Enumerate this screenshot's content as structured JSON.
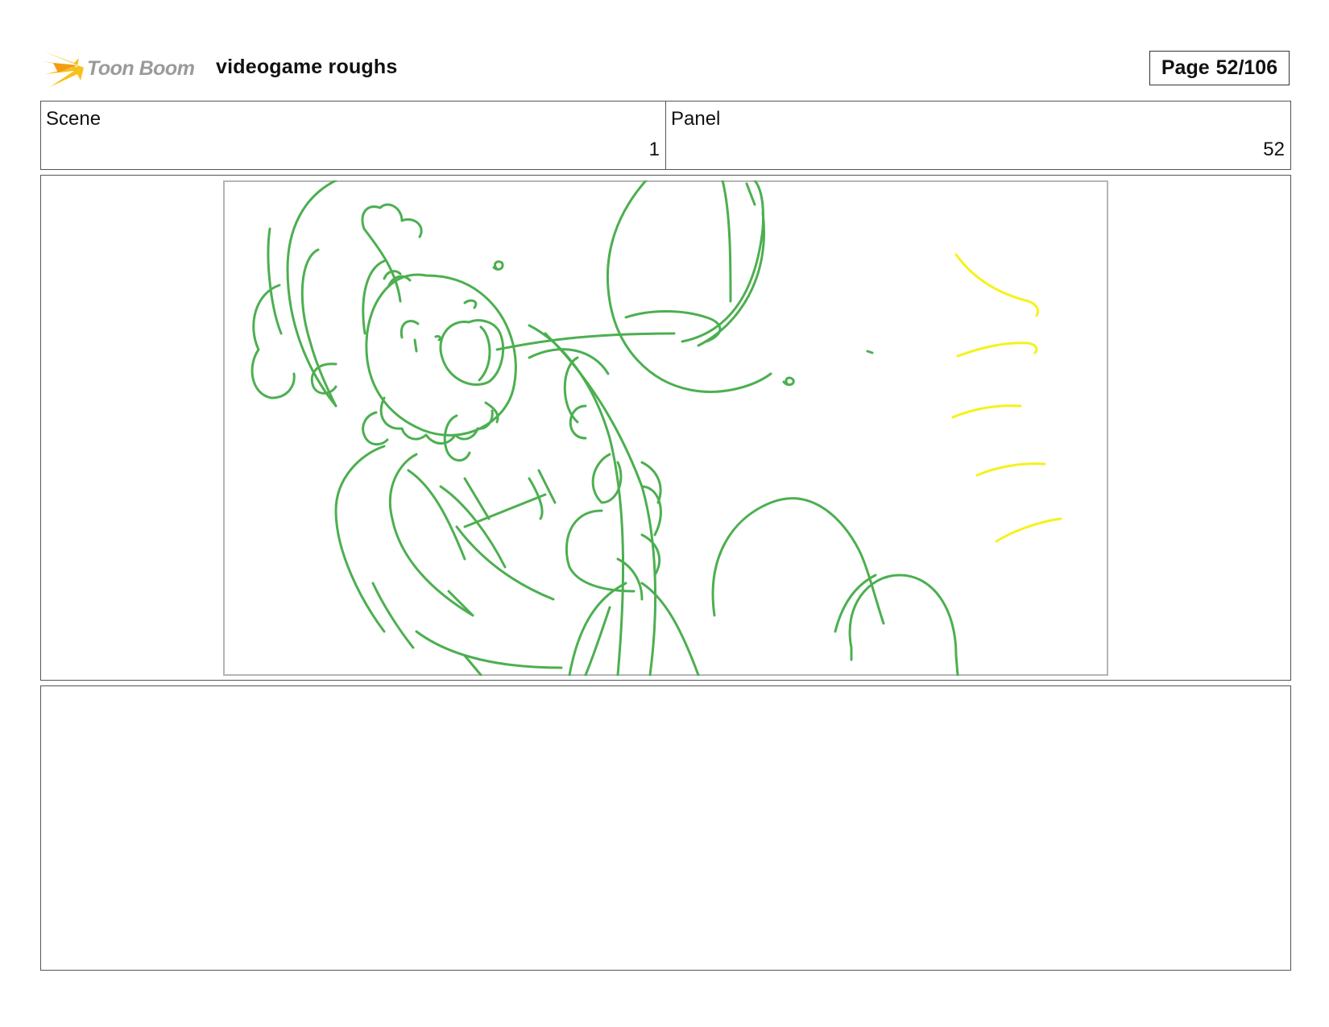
{
  "header": {
    "logo_text": "Toon Boom",
    "title": "videogame roughs",
    "page_label": "Page",
    "page_value": "52/106"
  },
  "info": {
    "scene_label": "Scene",
    "scene_value": "1",
    "panel_label": "Panel",
    "panel_value": "52"
  },
  "panel": {
    "image_icon": "storyboard-sketch",
    "line_colors": {
      "character": "#4caf50",
      "accent": "#f5f21a"
    },
    "frame_color": "#b5b5b5"
  },
  "notes": {
    "text": ""
  }
}
